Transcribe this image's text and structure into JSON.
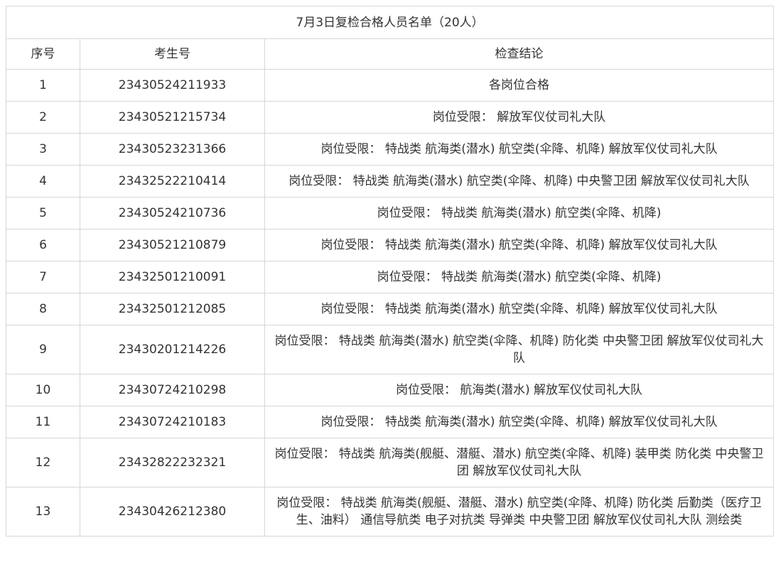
{
  "title": "7月3日复检合格人员名单（20人）",
  "headers": {
    "seq": "序号",
    "exam_id": "考生号",
    "result": "检查结论"
  },
  "rows": [
    {
      "seq": "1",
      "exam_id": "23430524211933",
      "result": "各岗位合格"
    },
    {
      "seq": "2",
      "exam_id": "23430521215734",
      "result": "岗位受限： 解放军仪仗司礼大队"
    },
    {
      "seq": "3",
      "exam_id": "23430523231366",
      "result": "岗位受限： 特战类 航海类(潜水) 航空类(伞降、机降) 解放军仪仗司礼大队"
    },
    {
      "seq": "4",
      "exam_id": "23432522210414",
      "result": "岗位受限： 特战类 航海类(潜水) 航空类(伞降、机降) 中央警卫团 解放军仪仗司礼大队"
    },
    {
      "seq": "5",
      "exam_id": "23430524210736",
      "result": "岗位受限： 特战类 航海类(潜水) 航空类(伞降、机降)"
    },
    {
      "seq": "6",
      "exam_id": "23430521210879",
      "result": "岗位受限： 特战类 航海类(潜水) 航空类(伞降、机降) 解放军仪仗司礼大队"
    },
    {
      "seq": "7",
      "exam_id": "23432501210091",
      "result": "岗位受限： 特战类 航海类(潜水) 航空类(伞降、机降)"
    },
    {
      "seq": "8",
      "exam_id": "23432501212085",
      "result": "岗位受限： 特战类 航海类(潜水) 航空类(伞降、机降) 解放军仪仗司礼大队"
    },
    {
      "seq": "9",
      "exam_id": "23430201214226",
      "result": "岗位受限： 特战类 航海类(潜水) 航空类(伞降、机降) 防化类 中央警卫团 解放军仪仗司礼大队"
    },
    {
      "seq": "10",
      "exam_id": "23430724210298",
      "result": "岗位受限： 航海类(潜水) 解放军仪仗司礼大队"
    },
    {
      "seq": "11",
      "exam_id": "23430724210183",
      "result": "岗位受限： 特战类 航海类(潜水) 航空类(伞降、机降) 解放军仪仗司礼大队"
    },
    {
      "seq": "12",
      "exam_id": "23432822232321",
      "result": "岗位受限： 特战类 航海类(舰艇、潜艇、潜水) 航空类(伞降、机降) 装甲类 防化类 中央警卫团 解放军仪仗司礼大队"
    },
    {
      "seq": "13",
      "exam_id": "23430426212380",
      "result": "岗位受限： 特战类 航海类(舰艇、潜艇、潜水) 航空类(伞降、机降) 防化类 后勤类（医疗卫生、油料） 通信导航类 电子对抗类 导弹类 中央警卫团 解放军仪仗司礼大队 测绘类"
    }
  ]
}
